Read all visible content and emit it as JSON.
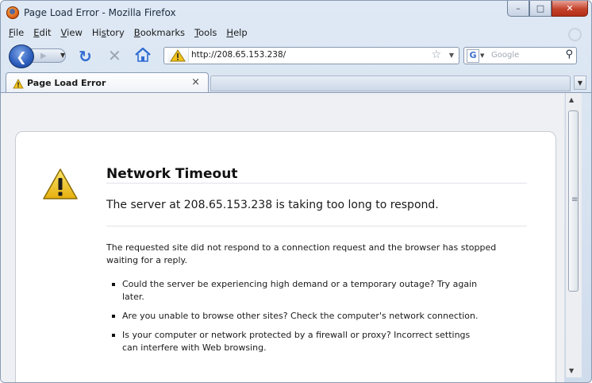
{
  "window": {
    "title": "Page Load Error - Mozilla Firefox",
    "controls": {
      "minimize": "–",
      "maximize": "□",
      "close": "✕"
    }
  },
  "menu": [
    {
      "label": "File",
      "accel": "F",
      "rest": "ile"
    },
    {
      "label": "Edit",
      "accel": "E",
      "rest": "dit"
    },
    {
      "label": "View",
      "accel": "V",
      "rest": "iew"
    },
    {
      "label": "History",
      "pre": "Hi",
      "accel": "s",
      "rest": "tory"
    },
    {
      "label": "Bookmarks",
      "accel": "B",
      "rest": "ookmarks"
    },
    {
      "label": "Tools",
      "accel": "T",
      "rest": "ools"
    },
    {
      "label": "Help",
      "accel": "H",
      "rest": "elp"
    }
  ],
  "nav": {
    "url": "http://208.65.153.238/",
    "search_engine_letter": "G",
    "search_placeholder": "Google"
  },
  "tab": {
    "label": "Page Load Error",
    "close": "×"
  },
  "error": {
    "title": "Network Timeout",
    "short_desc": "The server at 208.65.153.238 is taking too long to respond.",
    "long_desc": "The requested site did not respond to a connection request and the browser has stopped waiting for a reply.",
    "suggestions": [
      "Could the server be experiencing high demand or a temporary outage? Try again later.",
      "Are you unable to browse other sites? Check the computer's network connection.",
      "Is your computer or network protected by a firewall or proxy? Incorrect settings can interfere with Web browsing."
    ]
  },
  "colors": {
    "accent_blue": "#2a5cbb",
    "warning_yellow": "#f2c21b",
    "close_red": "#c4412a"
  }
}
